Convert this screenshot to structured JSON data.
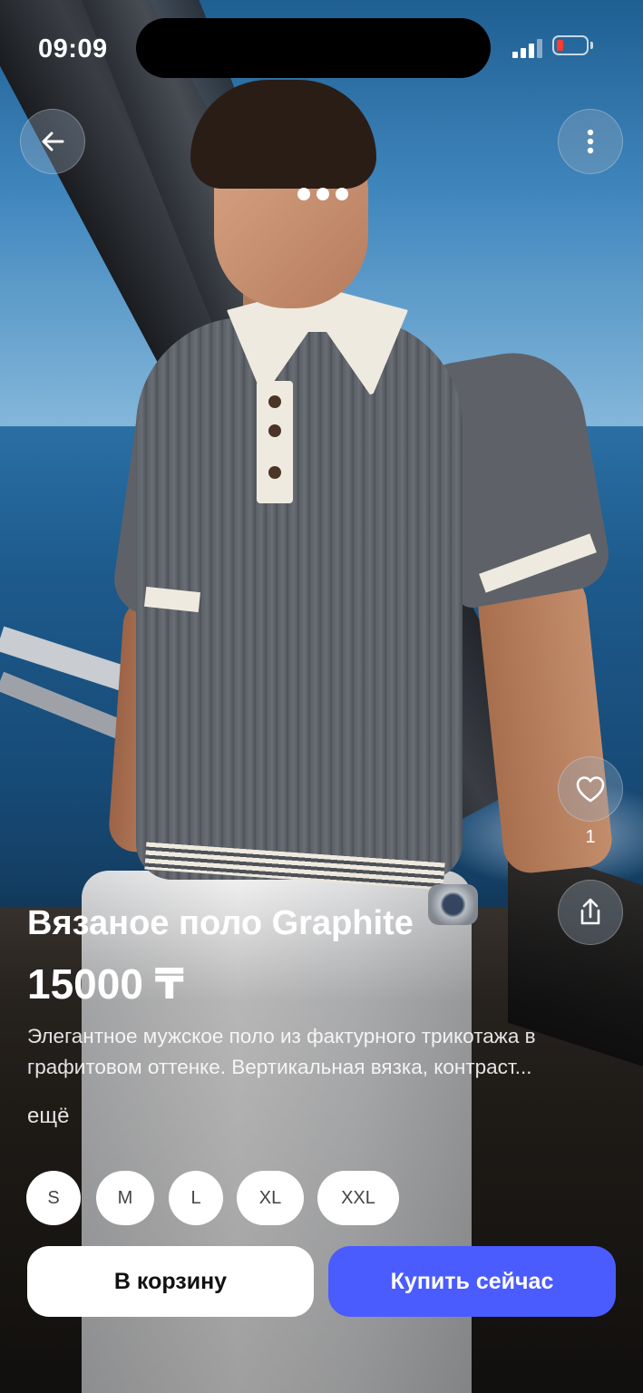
{
  "status_bar": {
    "time": "09:09"
  },
  "gallery": {
    "page_count": 3,
    "active_index": 0
  },
  "product": {
    "title": "Вязаное поло Graphite",
    "price": "15000 ₸",
    "description_line1": "Элегантное мужское поло из фактурного трикотажа в",
    "description_line2": "графитовом оттенке. Вертикальная вязка, контраст...",
    "more_label": "ещё"
  },
  "actions": {
    "like_count": "1"
  },
  "sizes": [
    "S",
    "M",
    "L",
    "XL",
    "XXL"
  ],
  "buttons": {
    "add_to_cart": "В корзину",
    "buy_now": "Купить сейчас"
  },
  "colors": {
    "accent": "#4b5cff",
    "battery_low": "#ff3b30"
  }
}
